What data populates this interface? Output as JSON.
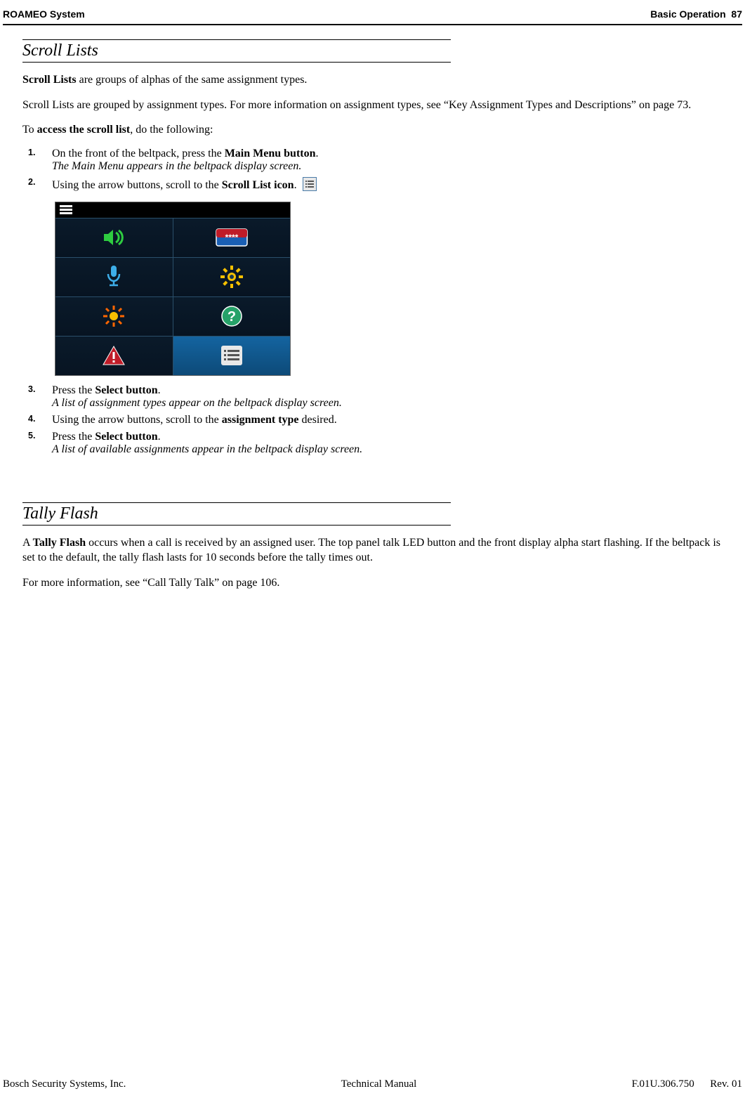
{
  "header": {
    "left": "ROAMEO System",
    "right_section": "Basic Operation",
    "right_page": "87"
  },
  "sections": {
    "scroll_lists": {
      "title": "Scroll Lists",
      "intro_bold": "Scroll Lists",
      "intro_rest": " are groups of alphas of the same assignment types.",
      "para2": "Scroll Lists are grouped by assignment types. For more information on assignment types, see “Key Assignment Types and Descriptions” on page 73.",
      "access_pre": "To ",
      "access_bold": "access the scroll list",
      "access_post": ", do the following:",
      "steps": [
        {
          "num": "1.",
          "line1_pre": "On the front of the beltpack, press the ",
          "line1_bold": "Main Menu button",
          "line1_post": ".",
          "result": "The Main Menu appears in the beltpack display screen."
        },
        {
          "num": "2.",
          "line1_pre": "Using the arrow buttons, scroll to the ",
          "line1_bold": "Scroll List icon",
          "line1_post": "."
        },
        {
          "num": "3.",
          "line1_pre": "Press the ",
          "line1_bold": "Select button",
          "line1_post": ".",
          "result": "A list of assignment types appear on the beltpack display screen."
        },
        {
          "num": "4.",
          "line1_pre": "Using the arrow buttons, scroll to the ",
          "line1_bold": "assignment type",
          "line1_post": " desired."
        },
        {
          "num": "5.",
          "line1_pre": "Press the ",
          "line1_bold": "Select button",
          "line1_post": ".",
          "result": "A list of available assignments appear in the beltpack display screen."
        }
      ]
    },
    "tally_flash": {
      "title": "Tally Flash",
      "p1_pre": "A ",
      "p1_bold": "Tally Flash",
      "p1_post": " occurs when a call is received by an assigned user. The top panel talk LED button and the front display alpha start flashing. If the beltpack is set to the default, the tally flash lasts for 10 seconds before the tally times out.",
      "p2": "For more information, see “Call Tally Talk” on page 106."
    }
  },
  "device_menu": {
    "icons": [
      [
        "speaker-icon",
        "keypad-icon"
      ],
      [
        "microphone-icon",
        "gear-icon"
      ],
      [
        "brightness-icon",
        "help-icon"
      ],
      [
        "alert-icon",
        "scroll-list-icon"
      ]
    ],
    "keypad_label": "****"
  },
  "footer": {
    "left": "Bosch Security Systems, Inc.",
    "center": "Technical Manual",
    "docnum": "F.01U.306.750",
    "rev": "Rev. 01"
  }
}
